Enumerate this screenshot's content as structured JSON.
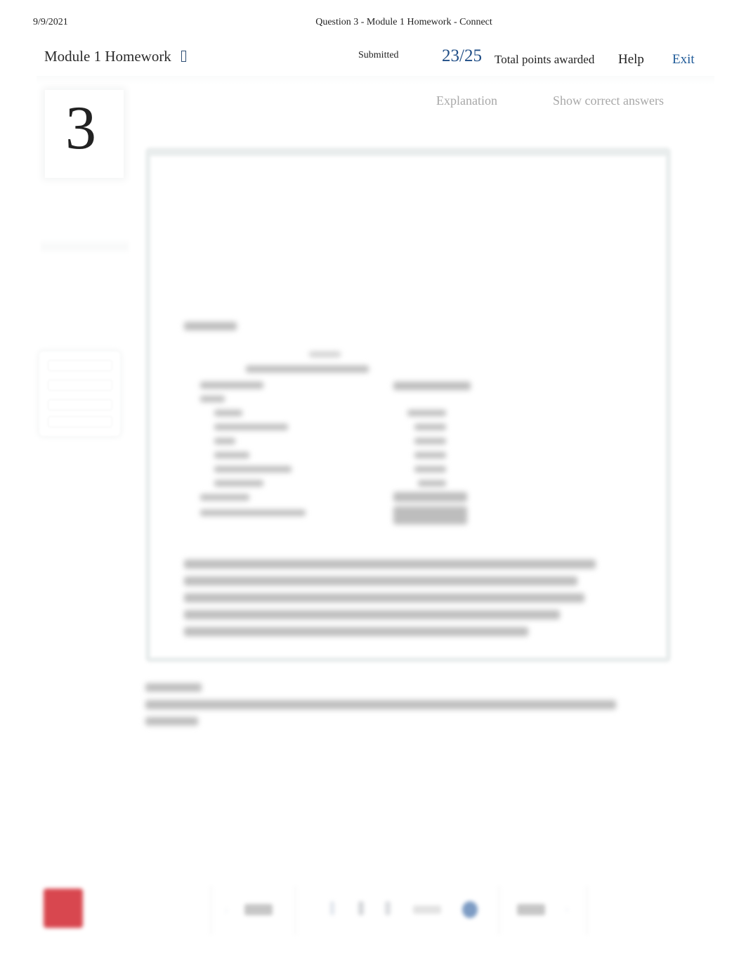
{
  "print_header": {
    "date": "9/9/2021",
    "title": "Question 3 - Module 1 Homework - Connect"
  },
  "header": {
    "assignment_title": "Module 1 Homework",
    "assignment_menu_icon": "dropdown-icon",
    "status": "Submitted",
    "score": "23/25",
    "score_label": "Total points awarded",
    "help_label": "Help",
    "exit_label": "Exit",
    "accent_color": "#1f4d86"
  },
  "question": {
    "number": "3",
    "explanation_label": "Explanation",
    "show_correct_answers_label": "Show correct answers",
    "content_state": "blurred/illegible"
  },
  "footer": {
    "logo_icon": "mcgraw-hill-logo",
    "prev_label_state": "blurred",
    "next_label_state": "blurred",
    "logo_color": "#d8474f"
  }
}
